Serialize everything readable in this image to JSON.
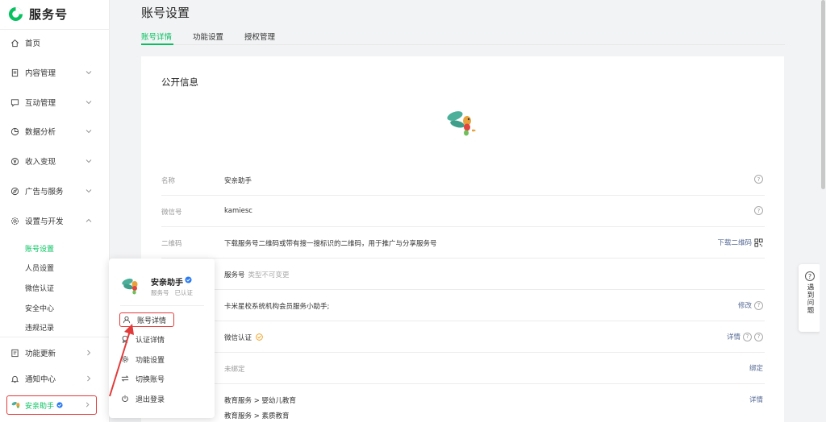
{
  "brand": {
    "name": "服务号",
    "color": "#07c160"
  },
  "sidebar": {
    "items": [
      {
        "label": "首页",
        "icon": "home-icon"
      },
      {
        "label": "内容管理",
        "icon": "document-icon"
      },
      {
        "label": "互动管理",
        "icon": "chat-icon"
      },
      {
        "label": "数据分析",
        "icon": "pie-chart-icon"
      },
      {
        "label": "收入变现",
        "icon": "yen-icon"
      },
      {
        "label": "广告与服务",
        "icon": "compass-icon"
      },
      {
        "label": "设置与开发",
        "icon": "gear-icon"
      }
    ],
    "sub_items": [
      {
        "label": "账号设置",
        "active": true
      },
      {
        "label": "人员设置"
      },
      {
        "label": "微信认证"
      },
      {
        "label": "安全中心"
      },
      {
        "label": "违规记录"
      }
    ],
    "bottom_items": [
      {
        "label": "功能更新",
        "icon": "update-icon"
      },
      {
        "label": "通知中心",
        "icon": "bell-icon"
      }
    ],
    "account": {
      "name": "安亲助手"
    }
  },
  "page": {
    "title": "账号设置",
    "tabs": [
      {
        "label": "账号详情",
        "active": true
      },
      {
        "label": "功能设置"
      },
      {
        "label": "授权管理"
      }
    ]
  },
  "card": {
    "section_title": "公开信息",
    "rows": [
      {
        "label": "名称",
        "value": "安亲助手"
      },
      {
        "label": "微信号",
        "value": "kamiesc"
      },
      {
        "label": "二维码",
        "value": "下载服务号二维码或带有搜一搜标识的二维码，用于推广与分享服务号",
        "action": "下载二维码"
      },
      {
        "value": "服务号",
        "muted": "类型不可变更"
      },
      {
        "value": "卡米星校系统机构会员服务小助手;",
        "action": "修改"
      },
      {
        "value": "微信认证",
        "action": "详情"
      },
      {
        "value": "未绑定",
        "action": "绑定"
      },
      {
        "value": "教育服务 > 婴幼儿教育",
        "action": "详情"
      }
    ],
    "extra_line": "教育服务 > 素质教育"
  },
  "help": {
    "icon": "?",
    "label": "遇到问题"
  },
  "popup": {
    "name": "安亲助手",
    "type": "服务号",
    "status": "已认证",
    "items": [
      {
        "label": "账号详情",
        "icon": "user-icon"
      },
      {
        "label": "认证详情",
        "icon": "certificate-icon"
      },
      {
        "label": "功能设置",
        "icon": "gear-icon"
      },
      {
        "label": "切换账号",
        "icon": "switch-icon"
      },
      {
        "label": "退出登录",
        "icon": "power-icon"
      }
    ]
  }
}
